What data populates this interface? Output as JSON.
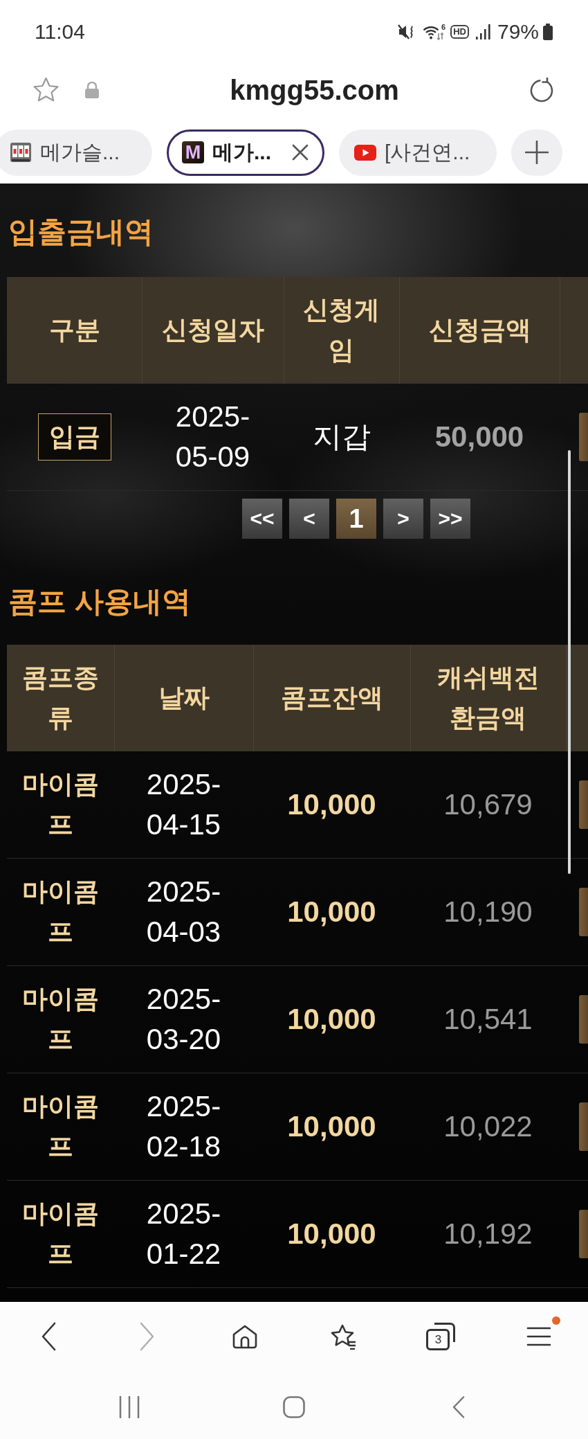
{
  "status_bar": {
    "time": "11:04",
    "wifi_label": "6",
    "call_badge": "HD",
    "battery": "79%"
  },
  "address_bar": {
    "url": "kmgg55.com"
  },
  "tabs": [
    {
      "label": "메가슬...",
      "selected": false
    },
    {
      "label": "메가...",
      "selected": true,
      "icon_letter": "M"
    },
    {
      "label": "[사건연...",
      "selected": false
    }
  ],
  "sections": [
    {
      "title": "입출금내역",
      "table": {
        "columns": [
          {
            "label": "구분",
            "kind": "badge"
          },
          {
            "label": "신청일자",
            "kind": "date"
          },
          {
            "label": "신청게임",
            "kind": "plain"
          },
          {
            "label": "신청금액",
            "kind": "faded"
          }
        ],
        "rows": [
          [
            "입금",
            "2025-05-09",
            "지갑",
            "50,000"
          ]
        ]
      },
      "pagination": {
        "first": "<<",
        "previous": "<",
        "pages": [
          {
            "label": "1",
            "selected": true
          }
        ],
        "next": ">",
        "last": ">>"
      }
    },
    {
      "title": "콤프 사용내역",
      "table": {
        "columns": [
          {
            "label": "콤프종류",
            "kind": "label"
          },
          {
            "label": "날짜",
            "kind": "date"
          },
          {
            "label": "콤프잔액",
            "kind": "amount"
          },
          {
            "label": "캐쉬백전환금액",
            "kind": "muted"
          }
        ],
        "rows": [
          [
            "마이콤프",
            "2025-04-15",
            "10,000",
            "10,679"
          ],
          [
            "마이콤프",
            "2025-04-03",
            "10,000",
            "10,190"
          ],
          [
            "마이콤프",
            "2025-03-20",
            "10,000",
            "10,541"
          ],
          [
            "마이콤프",
            "2025-02-18",
            "10,000",
            "10,022"
          ],
          [
            "마이콤프",
            "2025-01-22",
            "10,000",
            "10,192"
          ]
        ]
      }
    }
  ],
  "toolbar": {
    "back": {
      "disabled": false
    },
    "forward": {
      "disabled": true
    },
    "tab_count": "3",
    "menu_notification": true
  }
}
